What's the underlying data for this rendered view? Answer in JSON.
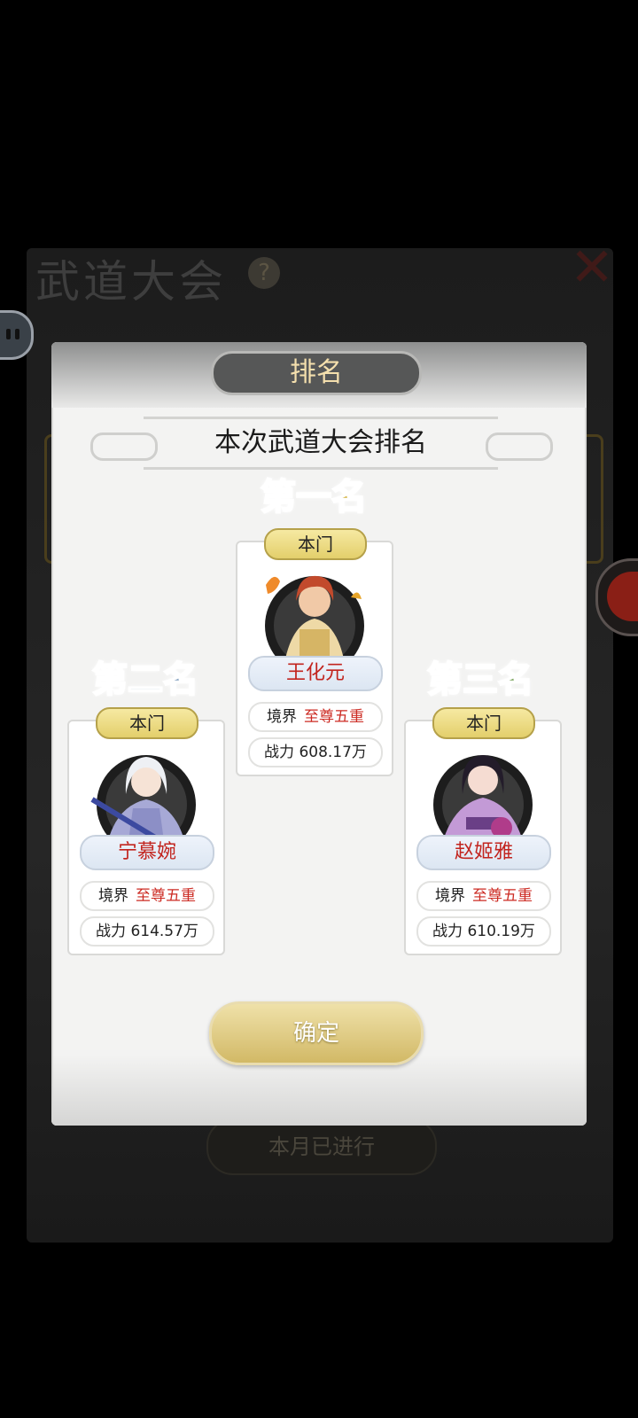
{
  "background": {
    "title": "武道大会",
    "help_glyph": "?",
    "close_glyph": "✕",
    "month_status": "本月已进行"
  },
  "dialog": {
    "tab_title": "排名",
    "subtitle": "本次武道大会排名",
    "confirm_label": "确定"
  },
  "ranks": [
    {
      "rank_label": "第一名",
      "rank_color": "#d6b84f",
      "badge": "本门",
      "name": "王化元",
      "realm_label": "境界",
      "realm_value": "至尊五重",
      "power_text": "战力 608.17万"
    },
    {
      "rank_label": "第二名",
      "rank_color": "#8aa6c2",
      "badge": "本门",
      "name": "宁慕婉",
      "realm_label": "境界",
      "realm_value": "至尊五重",
      "power_text": "战力 614.57万"
    },
    {
      "rank_label": "第三名",
      "rank_color": "#7fa862",
      "badge": "本门",
      "name": "赵姬雅",
      "realm_label": "境界",
      "realm_value": "至尊五重",
      "power_text": "战力 610.19万"
    }
  ]
}
